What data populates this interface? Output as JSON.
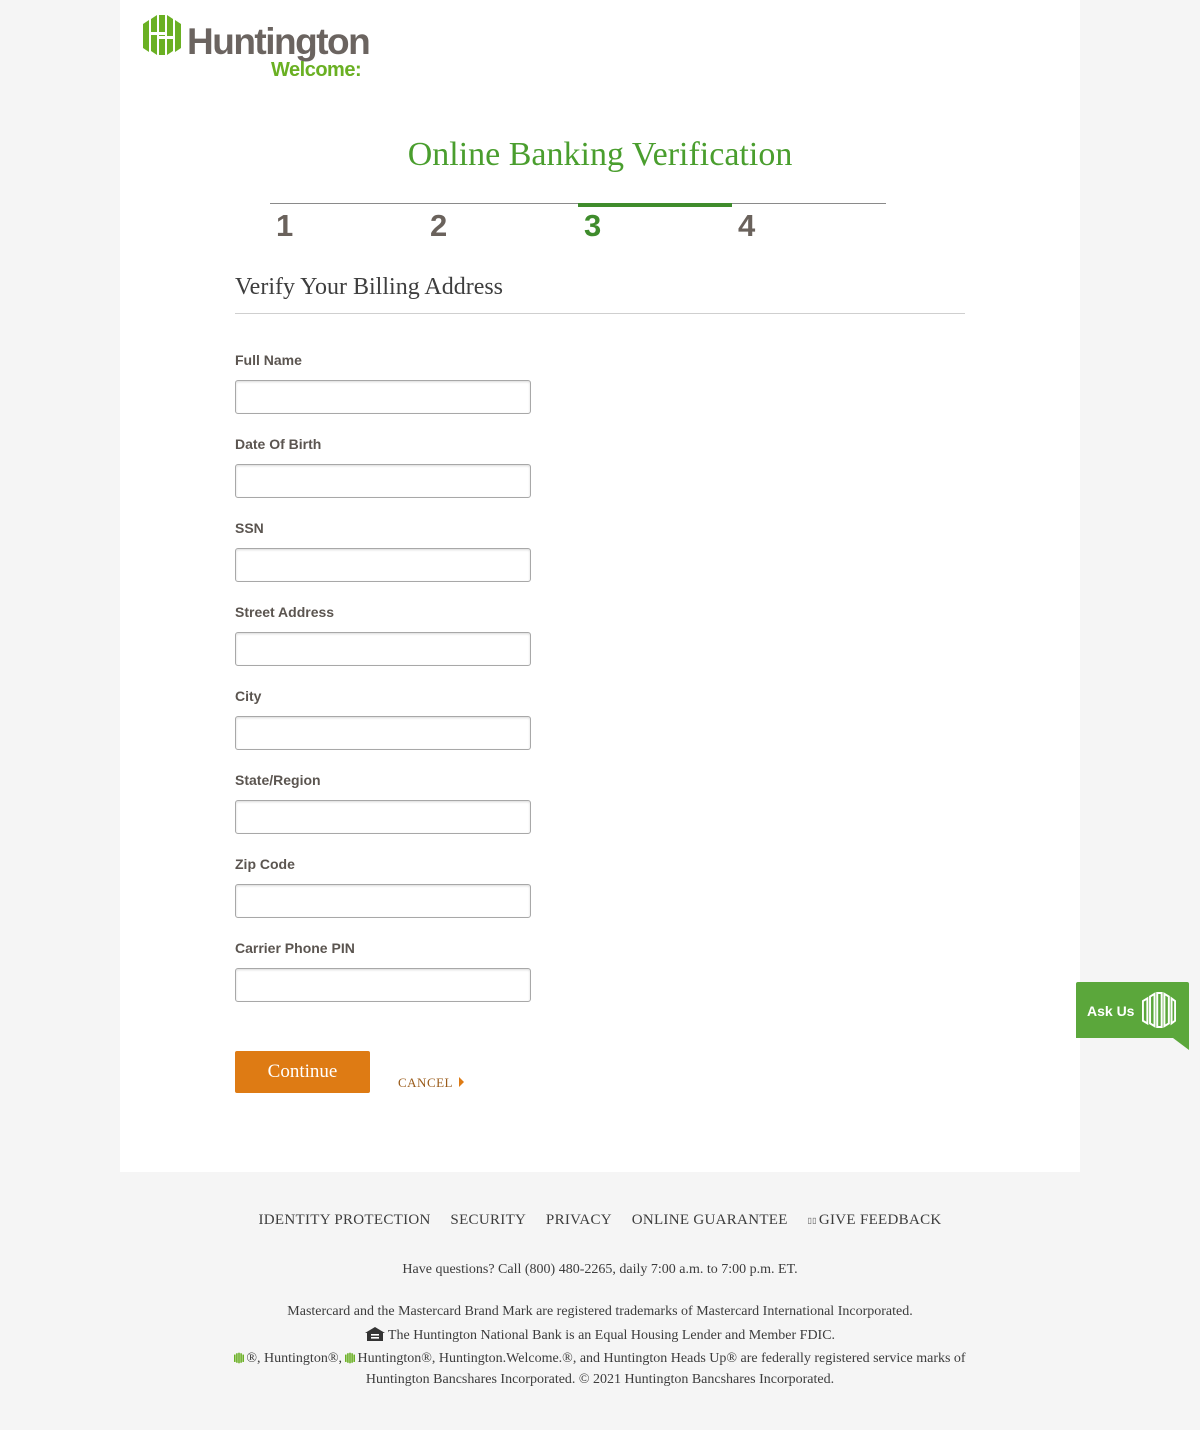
{
  "brand": {
    "name": "Huntington",
    "tagline": "Welcome:",
    "color_green": "#6ab023",
    "color_gray": "#6b6460"
  },
  "page": {
    "title": "Online Banking Verification",
    "steps": [
      {
        "label": "1",
        "active": false
      },
      {
        "label": "2",
        "active": false
      },
      {
        "label": "3",
        "active": true
      },
      {
        "label": "4",
        "active": false
      }
    ],
    "section_title": "Verify Your Billing Address"
  },
  "form": {
    "fields": [
      {
        "label": "Full Name",
        "value": ""
      },
      {
        "label": "Date Of Birth",
        "value": ""
      },
      {
        "label": "SSN",
        "value": ""
      },
      {
        "label": "Street Address",
        "value": ""
      },
      {
        "label": "City",
        "value": ""
      },
      {
        "label": "State/Region",
        "value": ""
      },
      {
        "label": "Zip Code",
        "value": ""
      },
      {
        "label": "Carrier Phone PIN",
        "value": ""
      }
    ],
    "continue_label": "Continue",
    "cancel_label": "CANCEL",
    "accent_color": "#de7b14"
  },
  "footer": {
    "links": {
      "identity": "IDENTITY PROTECTION",
      "security": "SECURITY",
      "privacy": "PRIVACY",
      "guarantee": "ONLINE GUARANTEE",
      "feedback": "GIVE FEEDBACK"
    },
    "questions": "Have questions? Call (800) 480-2265, daily 7:00 a.m. to 7:00 p.m. ET.",
    "mastercard": "Mastercard and the Mastercard Brand Mark are registered trademarks of Mastercard International Incorporated.",
    "fdic": "The Huntington National Bank is an Equal Housing Lender and Member FDIC.",
    "marks_part1": "®, Huntington®, ",
    "marks_part2": "Huntington®, Huntington.Welcome.®, and Huntington Heads Up® are federally registered service marks of Huntington Bancshares Incorporated. © 2021 Huntington Bancshares Incorporated."
  },
  "ask_us": {
    "label": "Ask Us",
    "color": "#5ba73b"
  }
}
